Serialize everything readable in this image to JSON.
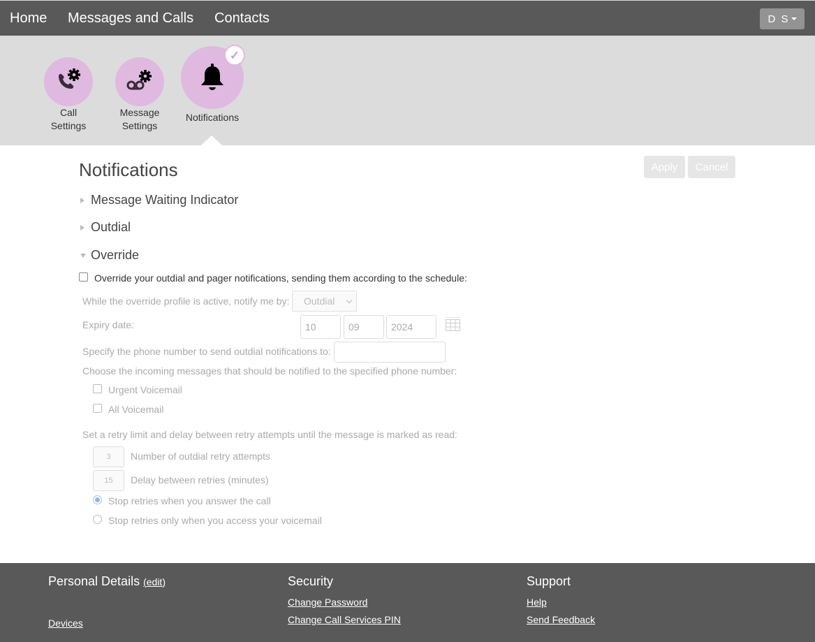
{
  "topnav": {
    "links": [
      "Home",
      "Messages and Calls",
      "Contacts"
    ],
    "user_initials": "D S"
  },
  "subnav": {
    "items": [
      {
        "line1": "Call",
        "line2": "Settings",
        "icon": "phone-gear-icon"
      },
      {
        "line1": "Message",
        "line2": "Settings",
        "icon": "voicemail-gear-icon"
      },
      {
        "line1": "Notifications",
        "line2": "",
        "icon": "bell-icon",
        "active": true
      }
    ],
    "check_glyph": "✓"
  },
  "main": {
    "title": "Notifications",
    "apply_label": "Apply",
    "cancel_label": "Cancel",
    "sections": [
      {
        "label": "Message Waiting Indicator",
        "expanded": false
      },
      {
        "label": "Outdial",
        "expanded": false
      },
      {
        "label": "Override",
        "expanded": true
      }
    ],
    "override": {
      "enable_label": "Override your outdial and pager notifications, sending them according to the schedule:",
      "enabled": false,
      "notify_by_label": "While the override profile is active, notify me by:",
      "notify_by_value": "Outdial",
      "expiry_label": "Expiry date:",
      "expiry_day": "10",
      "expiry_month": "09",
      "expiry_year": "2024",
      "phone_label": "Specify the phone number to send outdial notifications to:",
      "phone_value": "",
      "choose_label": "Choose the incoming messages that should be notified to the specified phone number:",
      "urgent_voicemail_label": "Urgent Voicemail",
      "all_voicemail_label": "All Voicemail",
      "retry_label": "Set a retry limit and delay between retry attempts until the message is marked as read:",
      "retry_attempts_value": "3",
      "retry_attempts_label": "Number of outdial retry attempts",
      "retry_delay_value": "15",
      "retry_delay_label": "Delay between retries (minutes)",
      "stop_answer_label": "Stop retries when you answer the call",
      "stop_voicemail_label": "Stop retries only when you access your voicemail",
      "stop_option_selected": "answer"
    }
  },
  "footer": {
    "personal": {
      "heading": "Personal Details",
      "edit_label": "edit",
      "devices_label": "Devices"
    },
    "security": {
      "heading": "Security",
      "links": [
        "Change Password",
        "Change Call Services PIN"
      ]
    },
    "support": {
      "heading": "Support",
      "links": [
        "Help",
        "Send Feedback"
      ]
    }
  }
}
